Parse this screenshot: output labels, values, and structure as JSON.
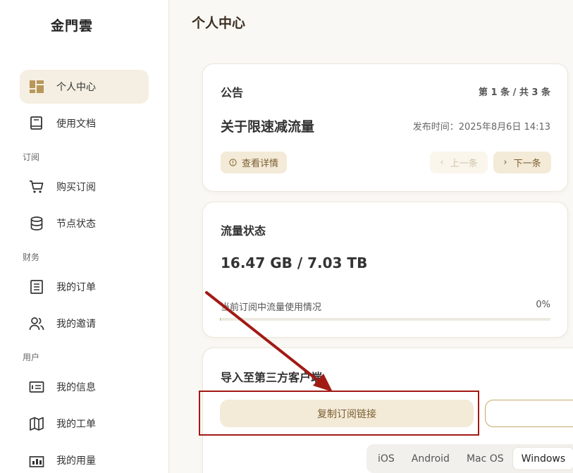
{
  "brand": "金門雲",
  "page_title": "个人中心",
  "sidebar": {
    "items": [
      {
        "label": "个人中心",
        "icon": "dashboard-icon",
        "active": true
      },
      {
        "label": "使用文档",
        "icon": "book-icon",
        "active": false
      }
    ],
    "sections": [
      {
        "title": "订阅",
        "items": [
          {
            "label": "购买订阅",
            "icon": "cart-icon"
          },
          {
            "label": "节点状态",
            "icon": "database-icon"
          }
        ]
      },
      {
        "title": "财务",
        "items": [
          {
            "label": "我的订单",
            "icon": "order-list-icon"
          },
          {
            "label": "我的邀请",
            "icon": "users-icon"
          }
        ]
      },
      {
        "title": "用户",
        "items": [
          {
            "label": "我的信息",
            "icon": "id-card-icon"
          },
          {
            "label": "我的工单",
            "icon": "map-icon"
          },
          {
            "label": "我的用量",
            "icon": "usage-chart-icon"
          }
        ]
      }
    ]
  },
  "announcement": {
    "title": "公告",
    "counter": "第 1 条 / 共 3 条",
    "headline": "关于限速减流量",
    "publish_time": "发布时间：2025年8月6日 14:13",
    "details_button": "查看详情",
    "prev_button": "上一条",
    "next_button": "下一条"
  },
  "traffic": {
    "title": "流量状态",
    "amount": "16.47 GB / 7.03 TB",
    "caption": "当前订阅中流量使用情况",
    "percent_label": "0%",
    "percent_value": 0.23
  },
  "import": {
    "title": "导入至第三方客户端",
    "copy_button": "复制订阅链接",
    "platform_tabs": [
      "iOS",
      "Android",
      "Mac OS",
      "Windows"
    ],
    "active_tab": "Windows"
  },
  "colors": {
    "accent": "#c7a86a",
    "accent_bg": "#f3ead8",
    "annotation": "#a11a14"
  }
}
